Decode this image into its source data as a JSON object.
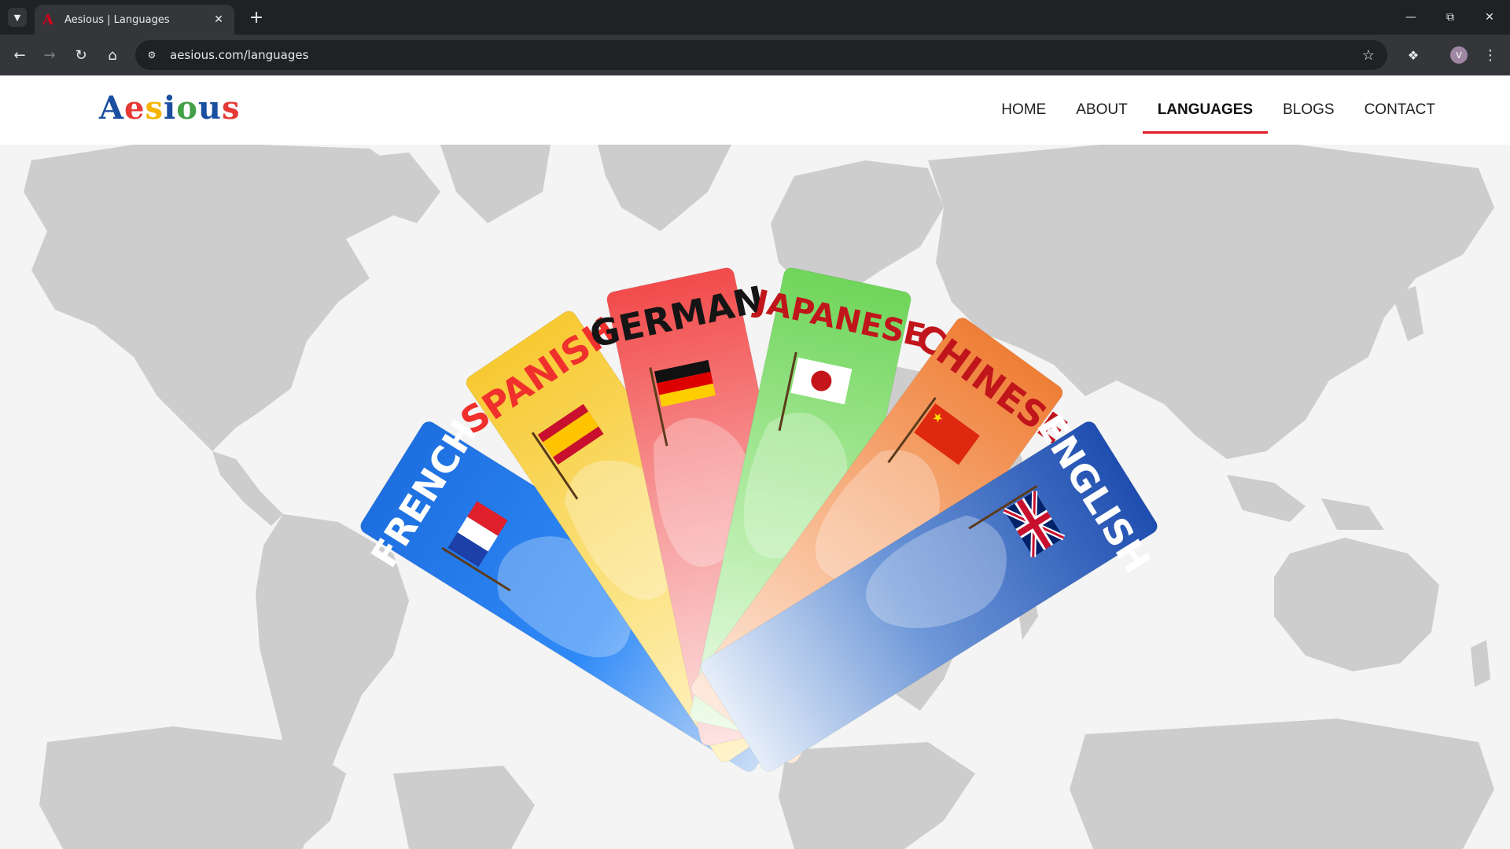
{
  "browser": {
    "tab_title": "Aesious | Languages",
    "tab_favicon": "A",
    "url": "aesious.com/languages",
    "profile_initial": "V",
    "icons": {
      "tab_list": "chevron-down-icon",
      "close": "close-icon",
      "new_tab": "plus-icon",
      "back": "arrow-left-icon",
      "forward": "arrow-right-icon",
      "reload": "reload-icon",
      "home": "home-icon",
      "site_info": "tune-icon",
      "bookmark": "star-icon",
      "extensions": "puzzle-icon",
      "menu": "kebab-menu-icon"
    }
  },
  "site": {
    "logo": {
      "letters": [
        {
          "char": "A",
          "color": "#1a4fa0"
        },
        {
          "char": "e",
          "color": "#e53935"
        },
        {
          "char": "s",
          "color": "#f4b400"
        },
        {
          "char": "i",
          "color": "#1a4fa0"
        },
        {
          "char": "o",
          "color": "#43a047"
        },
        {
          "char": "u",
          "color": "#1a4fa0"
        },
        {
          "char": "s",
          "color": "#e53935"
        }
      ]
    },
    "nav": [
      {
        "label": "HOME",
        "active": false
      },
      {
        "label": "ABOUT",
        "active": false
      },
      {
        "label": "LANGUAGES",
        "active": true
      },
      {
        "label": "BLOGS",
        "active": false
      },
      {
        "label": "CONTACT",
        "active": false
      }
    ],
    "accent_color": "#e31b23"
  },
  "hero": {
    "cards": [
      {
        "label": "FRENCH",
        "label_color": "#ffffff",
        "colors": [
          "#1e6fe0",
          "#2f8af7",
          "#c9dcf6"
        ],
        "flag": "france-flag"
      },
      {
        "label": "SPANISH",
        "label_color": "#f0302c",
        "colors": [
          "#f7c932",
          "#fbe27f",
          "#fff3cc"
        ],
        "flag": "spain-flag"
      },
      {
        "label": "GERMAN",
        "label_color": "#151515",
        "colors": [
          "#f24b4b",
          "#f8a4a4",
          "#fde3e3"
        ],
        "flag": "germany-flag"
      },
      {
        "label": "JAPANESE",
        "label_color": "#c0151b",
        "colors": [
          "#6fd55a",
          "#b4eca6",
          "#eefbea"
        ],
        "flag": "japan-flag"
      },
      {
        "label": "CHINESE",
        "label_color": "#c0151b",
        "colors": [
          "#ef7e36",
          "#f8b98f",
          "#fdeadd"
        ],
        "flag": "china-flag"
      },
      {
        "label": "ENGLISH",
        "label_color": "#ffffff",
        "colors": [
          "#1f4eb0",
          "#6d97d8",
          "#e6eef9"
        ],
        "flag": "uk-flag"
      }
    ]
  }
}
